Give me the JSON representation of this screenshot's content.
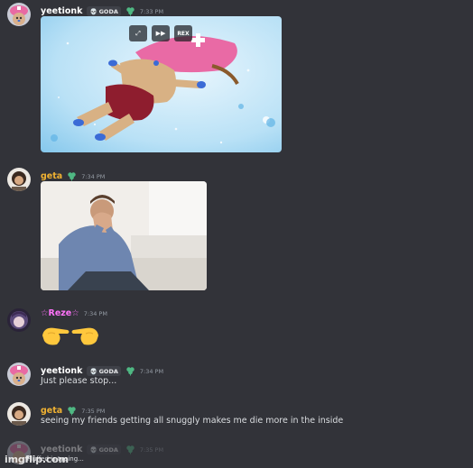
{
  "colors": {
    "background": "#323339",
    "text": "#dbdee1",
    "muted": "#949ba4",
    "yeetionk": "#ffffff",
    "geta": "#f0b232",
    "reze": "#ff73fa"
  },
  "messages": [
    {
      "username": "yeetionk",
      "tag": "GODA",
      "timestamp": "7:33 PM",
      "media_buttons": [
        "expand-icon",
        "gif-play-icon"
      ],
      "media_label": "REX"
    },
    {
      "username": "geta",
      "timestamp": "7:34 PM"
    },
    {
      "username": "☆Reze☆",
      "timestamp": "7:34 PM",
      "content_emoji": "pointing-fingers-emoji"
    },
    {
      "username": "yeetionk",
      "tag": "GODA",
      "timestamp": "7:34 PM",
      "content": "Just please stop..."
    },
    {
      "username": "geta",
      "timestamp": "7:35 PM",
      "content": "seeing my friends getting all snuggly makes me die more in the inside"
    },
    {
      "username": "yeetionk",
      "tag": "GODA",
      "timestamp": "7:35 PM"
    }
  ],
  "typing_indicator": "Fluffed is typing...",
  "watermark": "imgflip.com"
}
